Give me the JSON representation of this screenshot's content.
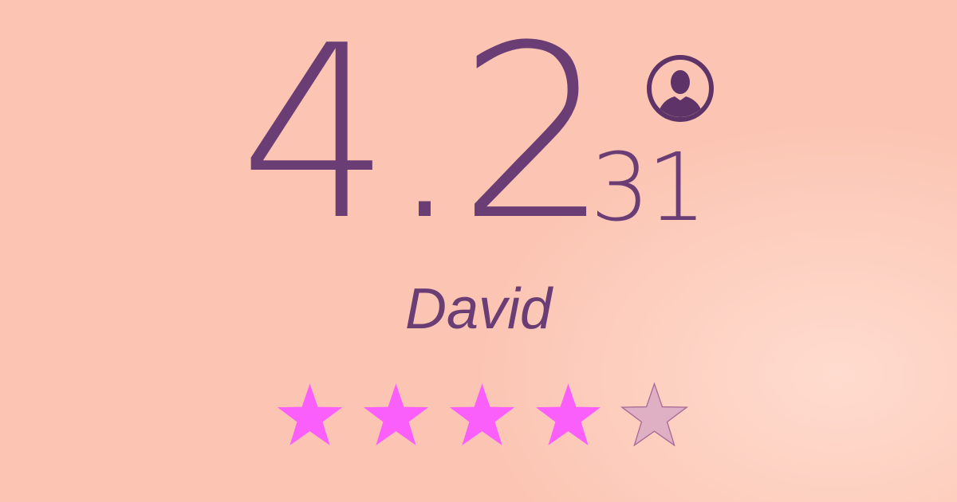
{
  "rating": {
    "value": "4.2",
    "review_count": "31",
    "stars_filled": 4,
    "stars_total": 5
  },
  "user": {
    "name": "David",
    "avatar_icon": "user-circle-icon"
  },
  "colors": {
    "text": "#6a3e75",
    "background": "#fcc5b3",
    "star_filled": "#fb5ffb",
    "star_empty": "#dfb0c4",
    "star_empty_stroke": "#a86a97"
  }
}
